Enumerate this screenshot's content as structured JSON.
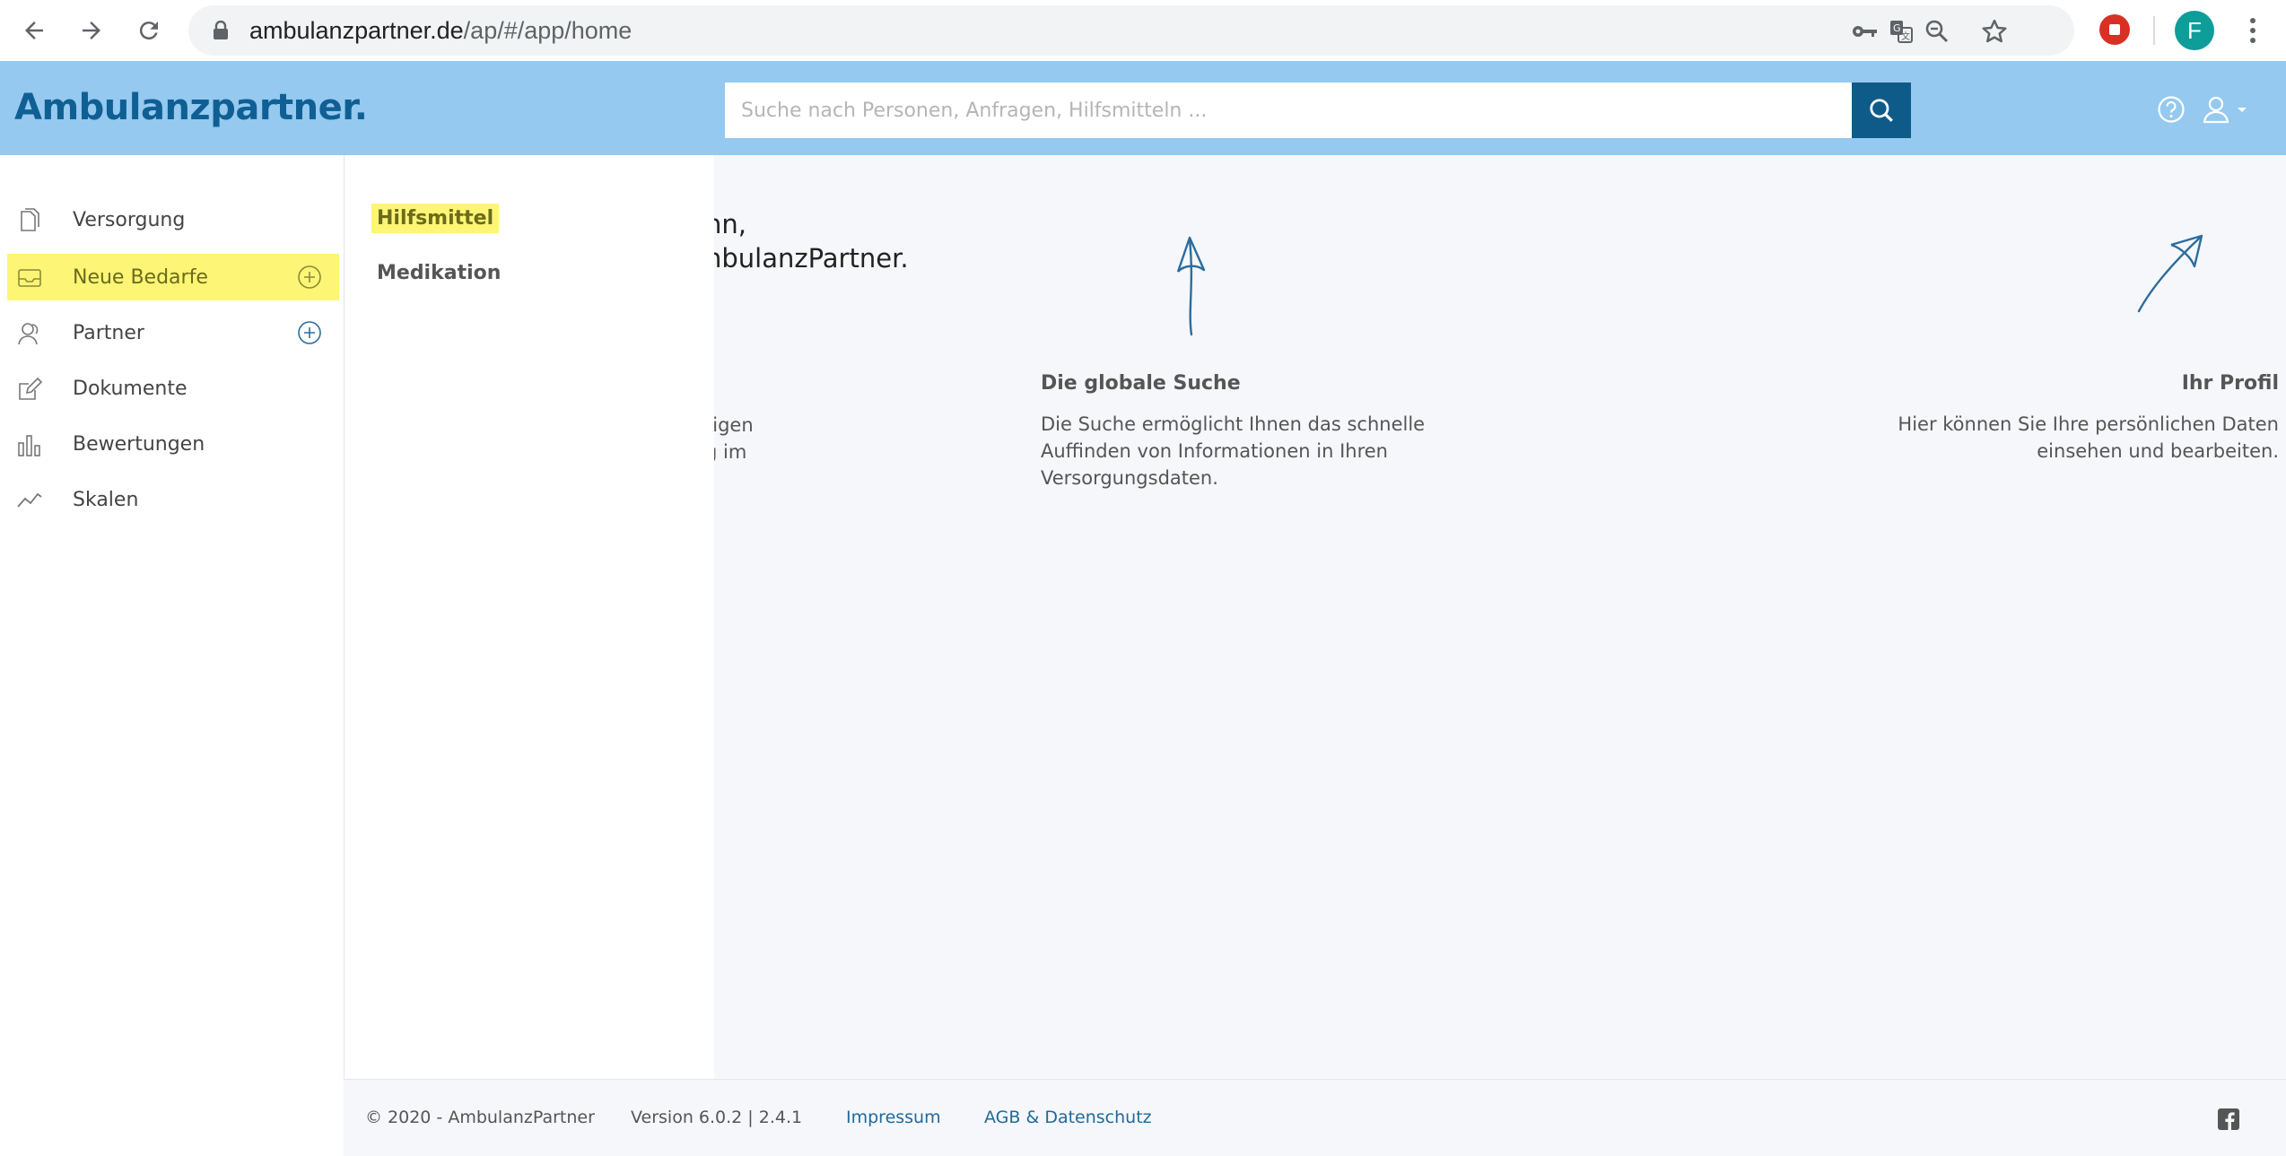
{
  "browser": {
    "url_domain": "ambulanzpartner.de",
    "url_path": "/ap/#/app/home",
    "profile_initial": "F"
  },
  "header": {
    "brand": "Ambulanzpartner.",
    "search_placeholder": "Suche nach Personen, Anfragen, Hilfsmitteln ..."
  },
  "sidebar": {
    "items": [
      {
        "label": "Versorgung",
        "icon": "documents-icon"
      },
      {
        "label": "Neue Bedarfe",
        "icon": "inbox-icon",
        "active": true,
        "plus": true
      },
      {
        "label": "Partner",
        "icon": "users-icon",
        "plus": true
      },
      {
        "label": "Dokumente",
        "icon": "edit-icon"
      },
      {
        "label": "Bewertungen",
        "icon": "bar-chart-icon"
      },
      {
        "label": "Skalen",
        "icon": "line-chart-icon"
      }
    ]
  },
  "submenu": {
    "items": [
      {
        "label": "Hilfsmittel",
        "active": true
      },
      {
        "label": "Medikation"
      }
    ]
  },
  "main": {
    "welcome_line1": "nn,",
    "welcome_line2": "nbulanzPartner.",
    "partial_line1": "tigen",
    "partial_line2": "g im",
    "search_hint": {
      "title": "Die globale Suche",
      "text_line1": "Die Suche ermöglicht Ihnen das schnelle",
      "text_line2": "Auffinden von Informationen in Ihren",
      "text_line3": "Versorgungsdaten."
    },
    "profile_hint": {
      "title": "Ihr Profil",
      "text_line1": "Hier können Sie Ihre persönlichen Daten",
      "text_line2": "einsehen und bearbeiten."
    }
  },
  "footer": {
    "copyright": "© 2020 - AmbulanzPartner",
    "version": "Version 6.0.2 | 2.4.1",
    "impressum": "Impressum",
    "agb": "AGB & Datenschutz"
  },
  "colors": {
    "header_bg": "#95c9ef",
    "brand": "#0f5f94",
    "highlight": "#fdf575",
    "search_button": "#0e5b8a"
  }
}
